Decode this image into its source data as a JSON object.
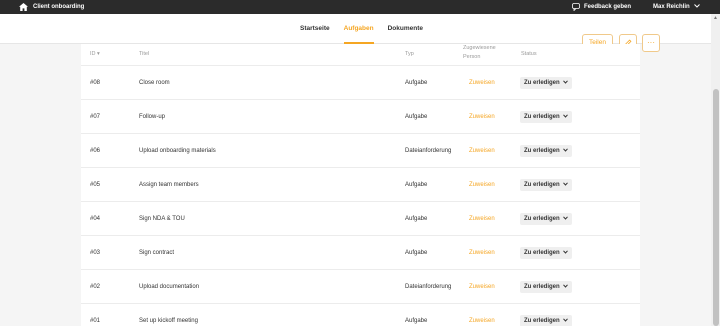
{
  "topbar": {
    "app_title": "Client onboarding",
    "home_icon": "home-icon",
    "feedback_label": "Feedback geben",
    "feedback_icon": "speech-bubble-icon",
    "user_name": "Max Reichlin",
    "user_chevron": "⌄"
  },
  "nav": {
    "tabs": [
      {
        "label": "Startseite",
        "active": false
      },
      {
        "label": "Aufgaben",
        "active": true
      },
      {
        "label": "Dokumente",
        "active": false
      }
    ],
    "share_label": "Teilen",
    "edit_icon": "pencil-icon",
    "more_icon": "···"
  },
  "table": {
    "headers": {
      "id": "ID",
      "id_sort": "▾",
      "title": "Titel",
      "type": "Typ",
      "person": "Zugewiesene Person",
      "status": "Status"
    },
    "rows": [
      {
        "id": "#08",
        "title": "Close room",
        "type": "Aufgabe",
        "assign": "Zuweisen",
        "status": "Zu erledigen"
      },
      {
        "id": "#07",
        "title": "Follow-up",
        "type": "Aufgabe",
        "assign": "Zuweisen",
        "status": "Zu erledigen"
      },
      {
        "id": "#06",
        "title": "Upload onboarding materials",
        "type": "Dateianforderung",
        "assign": "Zuweisen",
        "status": "Zu erledigen"
      },
      {
        "id": "#05",
        "title": "Assign team members",
        "type": "Aufgabe",
        "assign": "Zuweisen",
        "status": "Zu erledigen"
      },
      {
        "id": "#04",
        "title": "Sign NDA & TOU",
        "type": "Aufgabe",
        "assign": "Zuweisen",
        "status": "Zu erledigen"
      },
      {
        "id": "#03",
        "title": "Sign contract",
        "type": "Aufgabe",
        "assign": "Zuweisen",
        "status": "Zu erledigen"
      },
      {
        "id": "#02",
        "title": "Upload documentation",
        "type": "Dateianforderung",
        "assign": "Zuweisen",
        "status": "Zu erledigen"
      },
      {
        "id": "#01",
        "title": "Set up kickoff meeting",
        "type": "Aufgabe",
        "assign": "Zuweisen",
        "status": "Zu erledigen"
      }
    ],
    "status_chevron": "⌄"
  },
  "colors": {
    "accent": "#f5a623",
    "topbar_bg": "#2b2b2b",
    "page_bg": "#f5f5f5",
    "status_bg": "#efefef"
  }
}
